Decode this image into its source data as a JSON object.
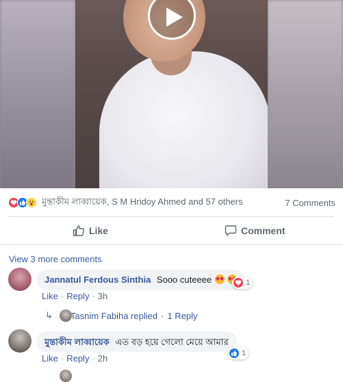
{
  "post": {
    "reaction_summary": "মুন্তাকীম লাব্বায়েক, S M Hridoy Ahmed and 57 others",
    "comment_count": "7 Comments",
    "actions": {
      "like_label": "Like",
      "comment_label": "Comment"
    }
  },
  "comments": {
    "view_more": "View 3 more comments",
    "items": [
      {
        "author": "Jannatul Ferdous Sinthia",
        "text": "Sooo cuteeee",
        "reaction_count": "1",
        "like_label": "Like",
        "reply_label": "Reply",
        "time": "3h",
        "replies": {
          "replier": "Tasnim Fabiha replied",
          "count": "1 Reply"
        }
      },
      {
        "author": "মুন্তাকীম লাব্বায়েক",
        "text": "এত বড় হয়ে গেলো মেয়ে আমার",
        "reaction_count": "1",
        "like_label": "Like",
        "reply_label": "Reply",
        "time": "2h"
      }
    ]
  },
  "colors": {
    "link": "#385898",
    "love": "#f33e58",
    "like": "#1877f2",
    "wow": "#f7d14b"
  }
}
